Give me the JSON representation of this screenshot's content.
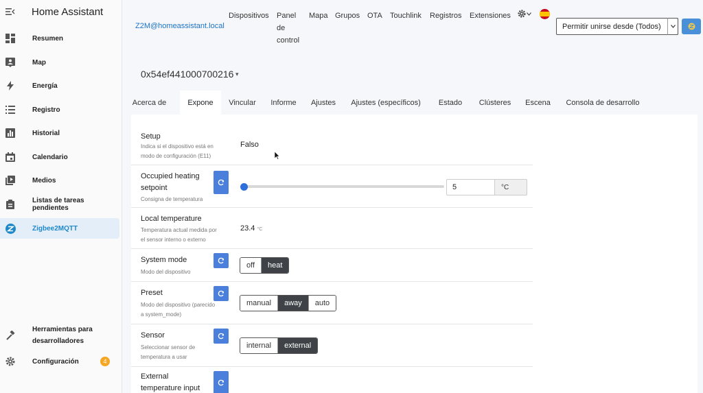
{
  "app": {
    "title": "Home Assistant"
  },
  "sidebar": {
    "items": [
      {
        "label": "Resumen",
        "icon": "dashboard-icon"
      },
      {
        "label": "Map",
        "icon": "map-person-icon"
      },
      {
        "label": "Energía",
        "icon": "lightning-icon"
      },
      {
        "label": "Registro",
        "icon": "list-icon"
      },
      {
        "label": "Historial",
        "icon": "chart-icon"
      },
      {
        "label": "Calendario",
        "icon": "calendar-icon"
      },
      {
        "label": "Medios",
        "icon": "media-icon"
      },
      {
        "label": "Listas de tareas pendientes",
        "icon": "clipboard-icon"
      },
      {
        "label": "Zigbee2MQTT",
        "icon": "zigbee-icon"
      }
    ],
    "dev_tools": {
      "line1": "Herramientas para",
      "line2": "desarrolladores"
    },
    "settings": {
      "label": "Configuración",
      "badge": "4"
    }
  },
  "topbar": {
    "z2m_link": "Z2M@homeassistant.local",
    "nav": {
      "devices": "Dispositivos",
      "panel1": "Panel",
      "panel2": "de",
      "panel3": "control",
      "map": "Mapa",
      "groups": "Grupos",
      "ota": "OTA",
      "touchlink": "Touchlink",
      "logs": "Registros",
      "extensions": "Extensiones"
    },
    "permit_join": "Permitir unirse desde (Todos)"
  },
  "device": {
    "name": "0x54ef441000700216"
  },
  "tabs": [
    "Acerca de",
    "Expone",
    "Vincular",
    "Informe",
    "Ajustes",
    "Ajustes (específicos)",
    "Estado",
    "Clústeres",
    "Escena",
    "Consola de desarrollo"
  ],
  "rows": {
    "setup": {
      "title": "Setup",
      "desc1": "Indica si el dispositivo está en",
      "desc2": "modo de configuración (E11)",
      "value": "Falso"
    },
    "heating": {
      "title1": "Occupied heating",
      "title2": "setpoint",
      "desc": "Consigna de temperatura",
      "value": "5",
      "unit": "°C",
      "slider_fraction": 0
    },
    "local_temp": {
      "title": "Local temperature",
      "desc1": "Temperatura actual medida por",
      "desc2": "el sensor interno o externo",
      "value": "23.4",
      "unit": "°C"
    },
    "system_mode": {
      "title": "System mode",
      "desc": "Modo del dispositivo",
      "options": [
        "off",
        "heat"
      ],
      "selected": "heat"
    },
    "preset": {
      "title": "Preset",
      "desc1": "Modo del dispositivo (parecido",
      "desc2": "a system_mode)",
      "options": [
        "manual",
        "away",
        "auto"
      ],
      "selected": "away"
    },
    "sensor": {
      "title": "Sensor",
      "desc1": "Seleccionar sensor de",
      "desc2": "temperatura a usar",
      "options": [
        "internal",
        "external"
      ],
      "selected": "external"
    },
    "ext_temp": {
      "title1": "External",
      "title2": "temperature input"
    }
  },
  "colors": {
    "accent": "#4a7fdc",
    "selected": "#3f4347",
    "link": "#1a73c8",
    "badge": "#f5a623"
  }
}
